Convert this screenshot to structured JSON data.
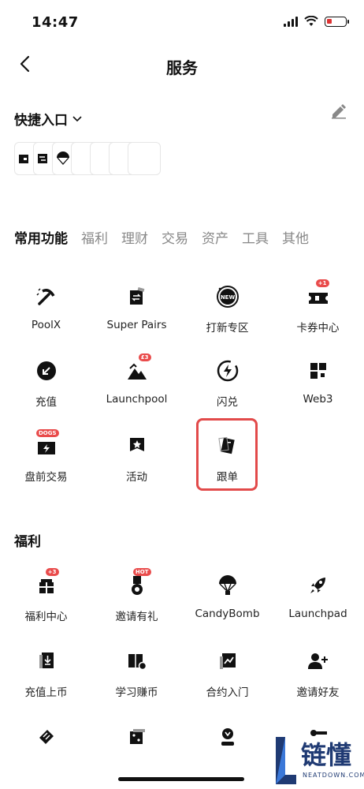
{
  "status_bar": {
    "time": "14:47"
  },
  "nav": {
    "title": "服务"
  },
  "quick_access": {
    "title": "快捷入口"
  },
  "tabs": [
    "常用功能",
    "福利",
    "理财",
    "交易",
    "资产",
    "工具",
    "其他"
  ],
  "common": [
    {
      "label": "PoolX",
      "icon": "pickaxe-icon"
    },
    {
      "label": "Super Pairs",
      "icon": "swap-card-icon"
    },
    {
      "label": "打新专区",
      "icon": "new-badge-icon",
      "badge": "NEW"
    },
    {
      "label": "卡券中心",
      "icon": "ticket-icon",
      "badge": "+1"
    },
    {
      "label": "充值",
      "icon": "deposit-icon"
    },
    {
      "label": "Launchpool",
      "icon": "mountain-icon",
      "badge": "£3"
    },
    {
      "label": "闪兑",
      "icon": "flash-icon"
    },
    {
      "label": "Web3",
      "icon": "web3-grid-icon"
    },
    {
      "label": "盘前交易",
      "icon": "premarket-icon",
      "badge": "DOGS"
    },
    {
      "label": "活动",
      "icon": "star-flag-icon"
    },
    {
      "label": "跟单",
      "icon": "copy-trade-icon"
    }
  ],
  "welfare_title": "福利",
  "welfare": [
    {
      "label": "福利中心",
      "icon": "gift-icon",
      "badge": "+3"
    },
    {
      "label": "邀请有礼",
      "icon": "medal-icon",
      "badge": "HOT"
    },
    {
      "label": "CandyBomb",
      "icon": "parachute-icon"
    },
    {
      "label": "Launchpad",
      "icon": "rocket-icon"
    },
    {
      "label": "充值上币",
      "icon": "list-coin-icon"
    },
    {
      "label": "学习赚币",
      "icon": "book-icon"
    },
    {
      "label": "合约入门",
      "icon": "chart-card-icon"
    },
    {
      "label": "邀请好友",
      "icon": "add-user-icon"
    }
  ],
  "watermark": {
    "text": "链懂",
    "sub": "NEATDOWN.COM"
  }
}
